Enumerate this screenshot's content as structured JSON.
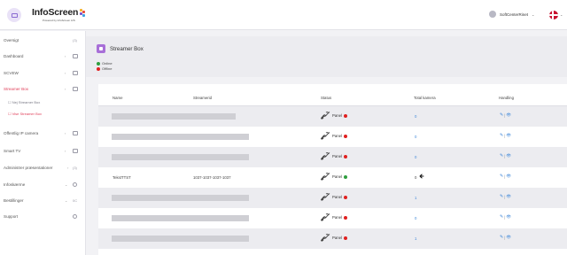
{
  "app": {
    "name": "InfoScreen",
    "tagline": "Powered by InfoScreen A/S"
  },
  "colors": {
    "accent": "#a86fd8",
    "active_nav": "#e0405a",
    "online": "#2e9e3e",
    "offline": "#e02020",
    "link": "#3f87d8"
  },
  "topbar": {
    "user_name": "SoftCenterRinet",
    "user_chevron": "⌄",
    "flag_chevron": "⌄",
    "menu_icon": "menu-icon"
  },
  "sidebar": {
    "items": [
      {
        "label": "Oversigt",
        "chevron": "",
        "icon": "(3)"
      },
      {
        "label": "Dashboard",
        "chevron": "›",
        "icon": ""
      },
      {
        "label": "SCVEW",
        "chevron": "›",
        "icon": ""
      },
      {
        "label": "Streamer Box",
        "chevron": "›",
        "icon": ""
      },
      {
        "label": "☐ Nej Streamer Box",
        "chevron": "",
        "icon": ""
      },
      {
        "label": "☐ Vise Streamer Box",
        "chevron": "",
        "icon": ""
      },
      {
        "label": "Offentlig IP camera",
        "chevron": "›",
        "icon": ""
      },
      {
        "label": "Smart TV",
        "chevron": "›",
        "icon": ""
      },
      {
        "label": "Administrer præsentationer",
        "chevron": "›",
        "icon": "(3)"
      },
      {
        "label": "Infoskærme",
        "chevron": "⌄",
        "icon": ""
      },
      {
        "label": "Bestillinger",
        "chevron": "⌄",
        "icon": "0C"
      },
      {
        "label": "Support",
        "chevron": "",
        "icon": ""
      }
    ]
  },
  "header": {
    "title": "Streamer Box",
    "legend": [
      {
        "label": "Online",
        "color": "#2e9e3e"
      },
      {
        "label": "Offline",
        "color": "#e02020"
      }
    ]
  },
  "table": {
    "columns": [
      "Name",
      "Streamerid",
      "Status",
      "Total kamera",
      "Handling"
    ],
    "rows": [
      {
        "name": "",
        "streamerid": "",
        "status": "Panel",
        "status_color": "#e02020",
        "total": "0",
        "arrow": ""
      },
      {
        "name": "",
        "streamerid": "",
        "status": "Panel",
        "status_color": "#e02020",
        "total": "0",
        "arrow": ""
      },
      {
        "name": "",
        "streamerid": "",
        "status": "Panel",
        "status_color": "#e02020",
        "total": "0",
        "arrow": ""
      },
      {
        "name": "TekstTTST",
        "streamerid": "1037-1037-1037-1037",
        "status": "Panel",
        "status_color": "#2e9e3e",
        "total": "0",
        "arrow": "🡸"
      },
      {
        "name": "",
        "streamerid": "",
        "status": "Panel",
        "status_color": "#e02020",
        "total": "1",
        "arrow": ""
      },
      {
        "name": "",
        "streamerid": "",
        "status": "Panel",
        "status_color": "#e02020",
        "total": "0",
        "arrow": ""
      },
      {
        "name": "",
        "streamerid": "",
        "status": "Panel",
        "status_color": "#e02020",
        "total": "1",
        "arrow": ""
      }
    ],
    "action_edit": "✎",
    "action_sep": "|",
    "action_view": "👁"
  }
}
